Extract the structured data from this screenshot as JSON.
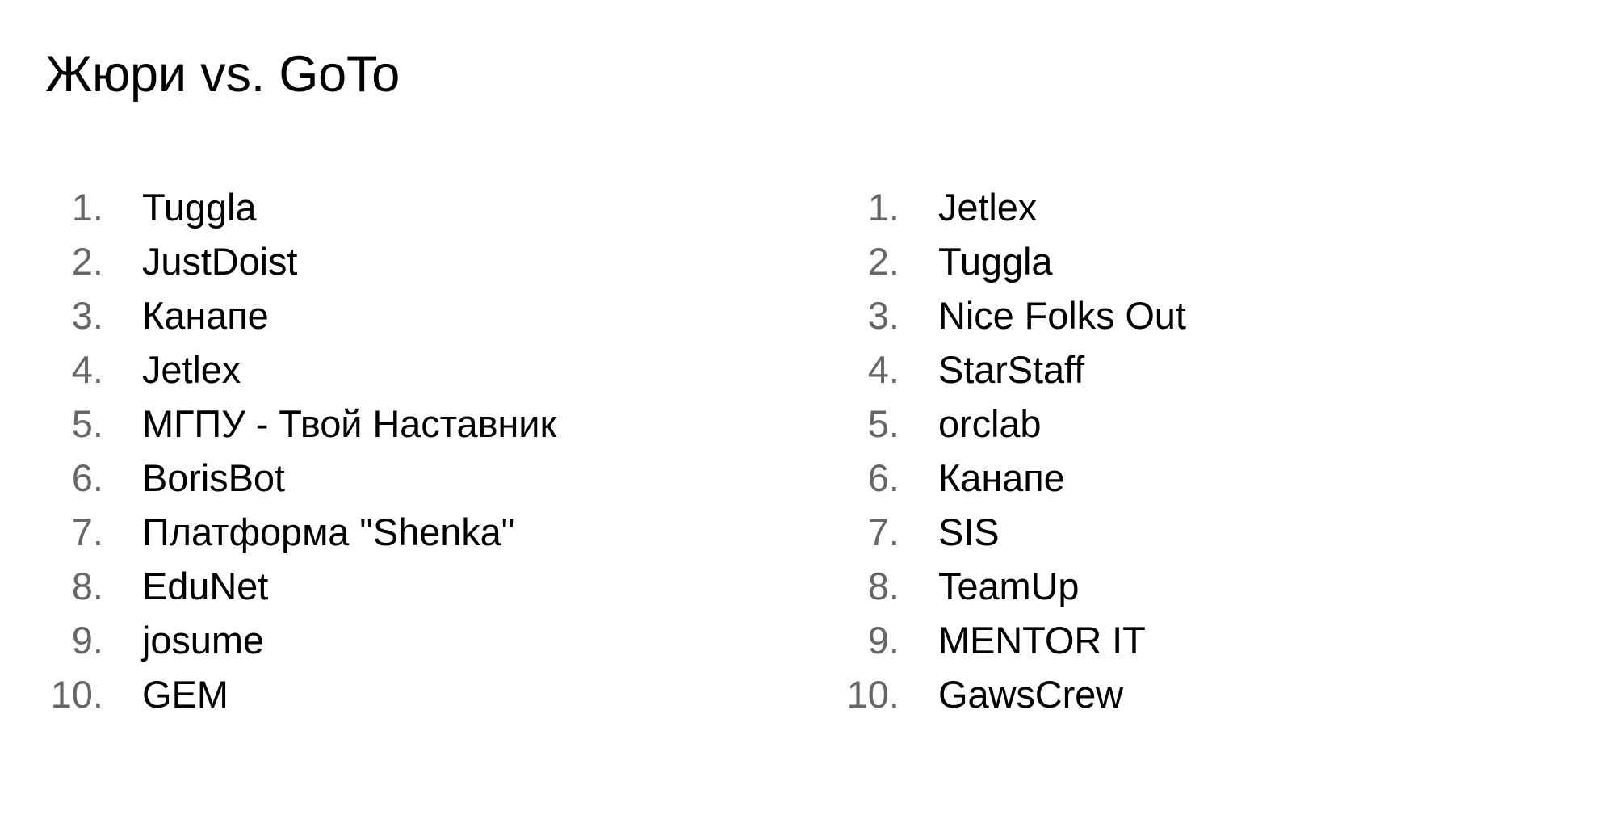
{
  "slide": {
    "title": "Жюри vs. GoTo",
    "background_color": "#ffffff",
    "text_color": "#000000",
    "marker_color": "#666666"
  },
  "columns": [
    {
      "name": "jury-ranking",
      "items": [
        {
          "marker": "1.",
          "label": "Tuggla"
        },
        {
          "marker": "2.",
          "label": "JustDoist"
        },
        {
          "marker": "3.",
          "label": "Канапе"
        },
        {
          "marker": "4.",
          "label": "Jetlex"
        },
        {
          "marker": "5.",
          "label": "МГПУ - Твой Наставник"
        },
        {
          "marker": "6.",
          "label": "BorisBot"
        },
        {
          "marker": "7.",
          "label": "Платформа \"Shenka\""
        },
        {
          "marker": "8.",
          "label": "EduNet"
        },
        {
          "marker": "9.",
          "label": "josume"
        },
        {
          "marker": "10.",
          "label": "GEM"
        }
      ]
    },
    {
      "name": "goto-ranking",
      "items": [
        {
          "marker": "1.",
          "label": "Jetlex"
        },
        {
          "marker": "2.",
          "label": "Tuggla"
        },
        {
          "marker": "3.",
          "label": "Nice Folks Out"
        },
        {
          "marker": "4.",
          "label": "StarStaff"
        },
        {
          "marker": "5.",
          "label": "orclab"
        },
        {
          "marker": "6.",
          "label": "Канапе"
        },
        {
          "marker": "7.",
          "label": "SIS"
        },
        {
          "marker": "8.",
          "label": "TeamUp"
        },
        {
          "marker": "9.",
          "label": "MENTOR IT"
        },
        {
          "marker": "10.",
          "label": "GawsCrew"
        }
      ]
    }
  ]
}
